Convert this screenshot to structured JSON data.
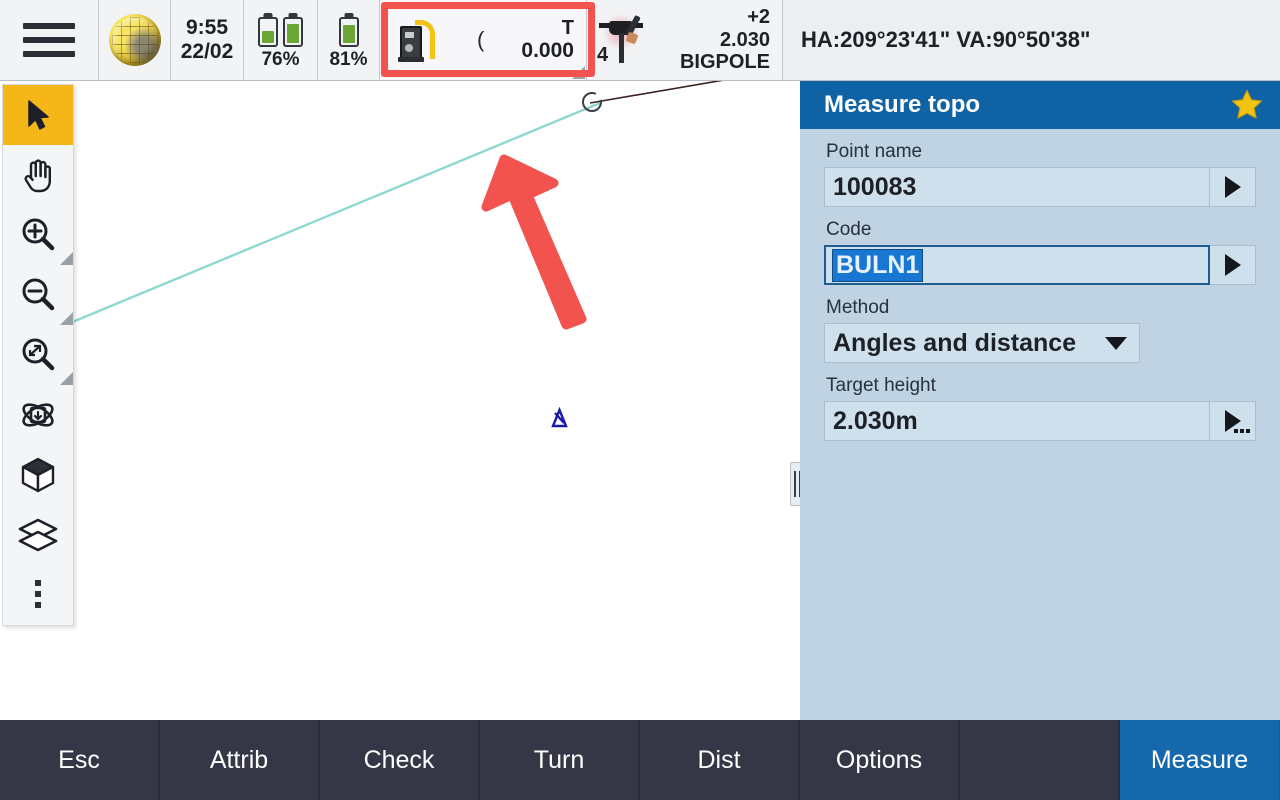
{
  "topbar": {
    "menu_icon": "hamburger-menu-icon",
    "globe_icon": "globe-icon",
    "clock": {
      "time": "9:55",
      "date": "22/02"
    },
    "battery_primary": {
      "label": "76%",
      "icon": "battery-icon"
    },
    "battery_secondary": {
      "label": "81%",
      "icon": "battery-icon"
    },
    "instrument": {
      "icon": "total-station-icon",
      "paren": "(",
      "type_label": "T",
      "value": "0.000"
    },
    "target": {
      "icon": "prism-target-icon",
      "number": "4",
      "offset": "+2",
      "height": "2.030",
      "name": "BIGPOLE"
    },
    "angles": "HA:209°23'41\"  VA:90°50'38\""
  },
  "toolbar": {
    "items": [
      {
        "name": "select-tool",
        "icon": "cursor-arrow-icon",
        "active": true,
        "has_submenu": false
      },
      {
        "name": "pan-tool",
        "icon": "hand-pan-icon",
        "active": false,
        "has_submenu": false
      },
      {
        "name": "zoom-in-tool",
        "icon": "magnifier-plus-icon",
        "active": false,
        "has_submenu": true
      },
      {
        "name": "zoom-out-tool",
        "icon": "magnifier-minus-icon",
        "active": false,
        "has_submenu": true
      },
      {
        "name": "zoom-extents-tool",
        "icon": "magnifier-scan-icon",
        "active": false,
        "has_submenu": true
      },
      {
        "name": "orbit-tool",
        "icon": "orbit-rotate-icon",
        "active": false,
        "has_submenu": false
      },
      {
        "name": "view-3d-tool",
        "icon": "cube-icon",
        "active": false,
        "has_submenu": false
      },
      {
        "name": "layers-tool",
        "icon": "layers-icon",
        "active": false,
        "has_submenu": false
      },
      {
        "name": "more-tools",
        "icon": "more-vertical-icon",
        "active": false,
        "has_submenu": false
      }
    ]
  },
  "panel": {
    "title": "Measure topo",
    "favorite_icon": "star-icon",
    "fields": {
      "point_name": {
        "label": "Point name",
        "value": "100083"
      },
      "code": {
        "label": "Code",
        "value": "BULN1",
        "focused": true,
        "selected": true
      },
      "method": {
        "label": "Method",
        "value": "Angles and distance"
      },
      "target_height": {
        "label": "Target height",
        "value": "2.030m"
      }
    }
  },
  "bottombar": {
    "buttons": [
      {
        "label": "Esc",
        "primary": false
      },
      {
        "label": "Attrib",
        "primary": false
      },
      {
        "label": "Check",
        "primary": false
      },
      {
        "label": "Turn",
        "primary": false
      },
      {
        "label": "Dist",
        "primary": false
      },
      {
        "label": "Options",
        "primary": false
      },
      {
        "label": "",
        "primary": false
      },
      {
        "label": "Measure",
        "primary": true
      }
    ]
  },
  "annotation": {
    "highlight_color": "#f3534f",
    "highlight_target": "instrument-status-cell",
    "arrow_icon": "annotation-arrow-icon"
  },
  "map": {
    "line_color": "#8fd8d0",
    "point_marker_color": "#1a1aa8",
    "background": "#ffffff"
  },
  "colors": {
    "panel_header": "#0f63a5",
    "panel_body": "#bfd3e3",
    "accent_yellow": "#f5b618",
    "bottom_bar": "#353746",
    "primary_button": "#1568ab",
    "selection_blue": "#1877d2"
  }
}
